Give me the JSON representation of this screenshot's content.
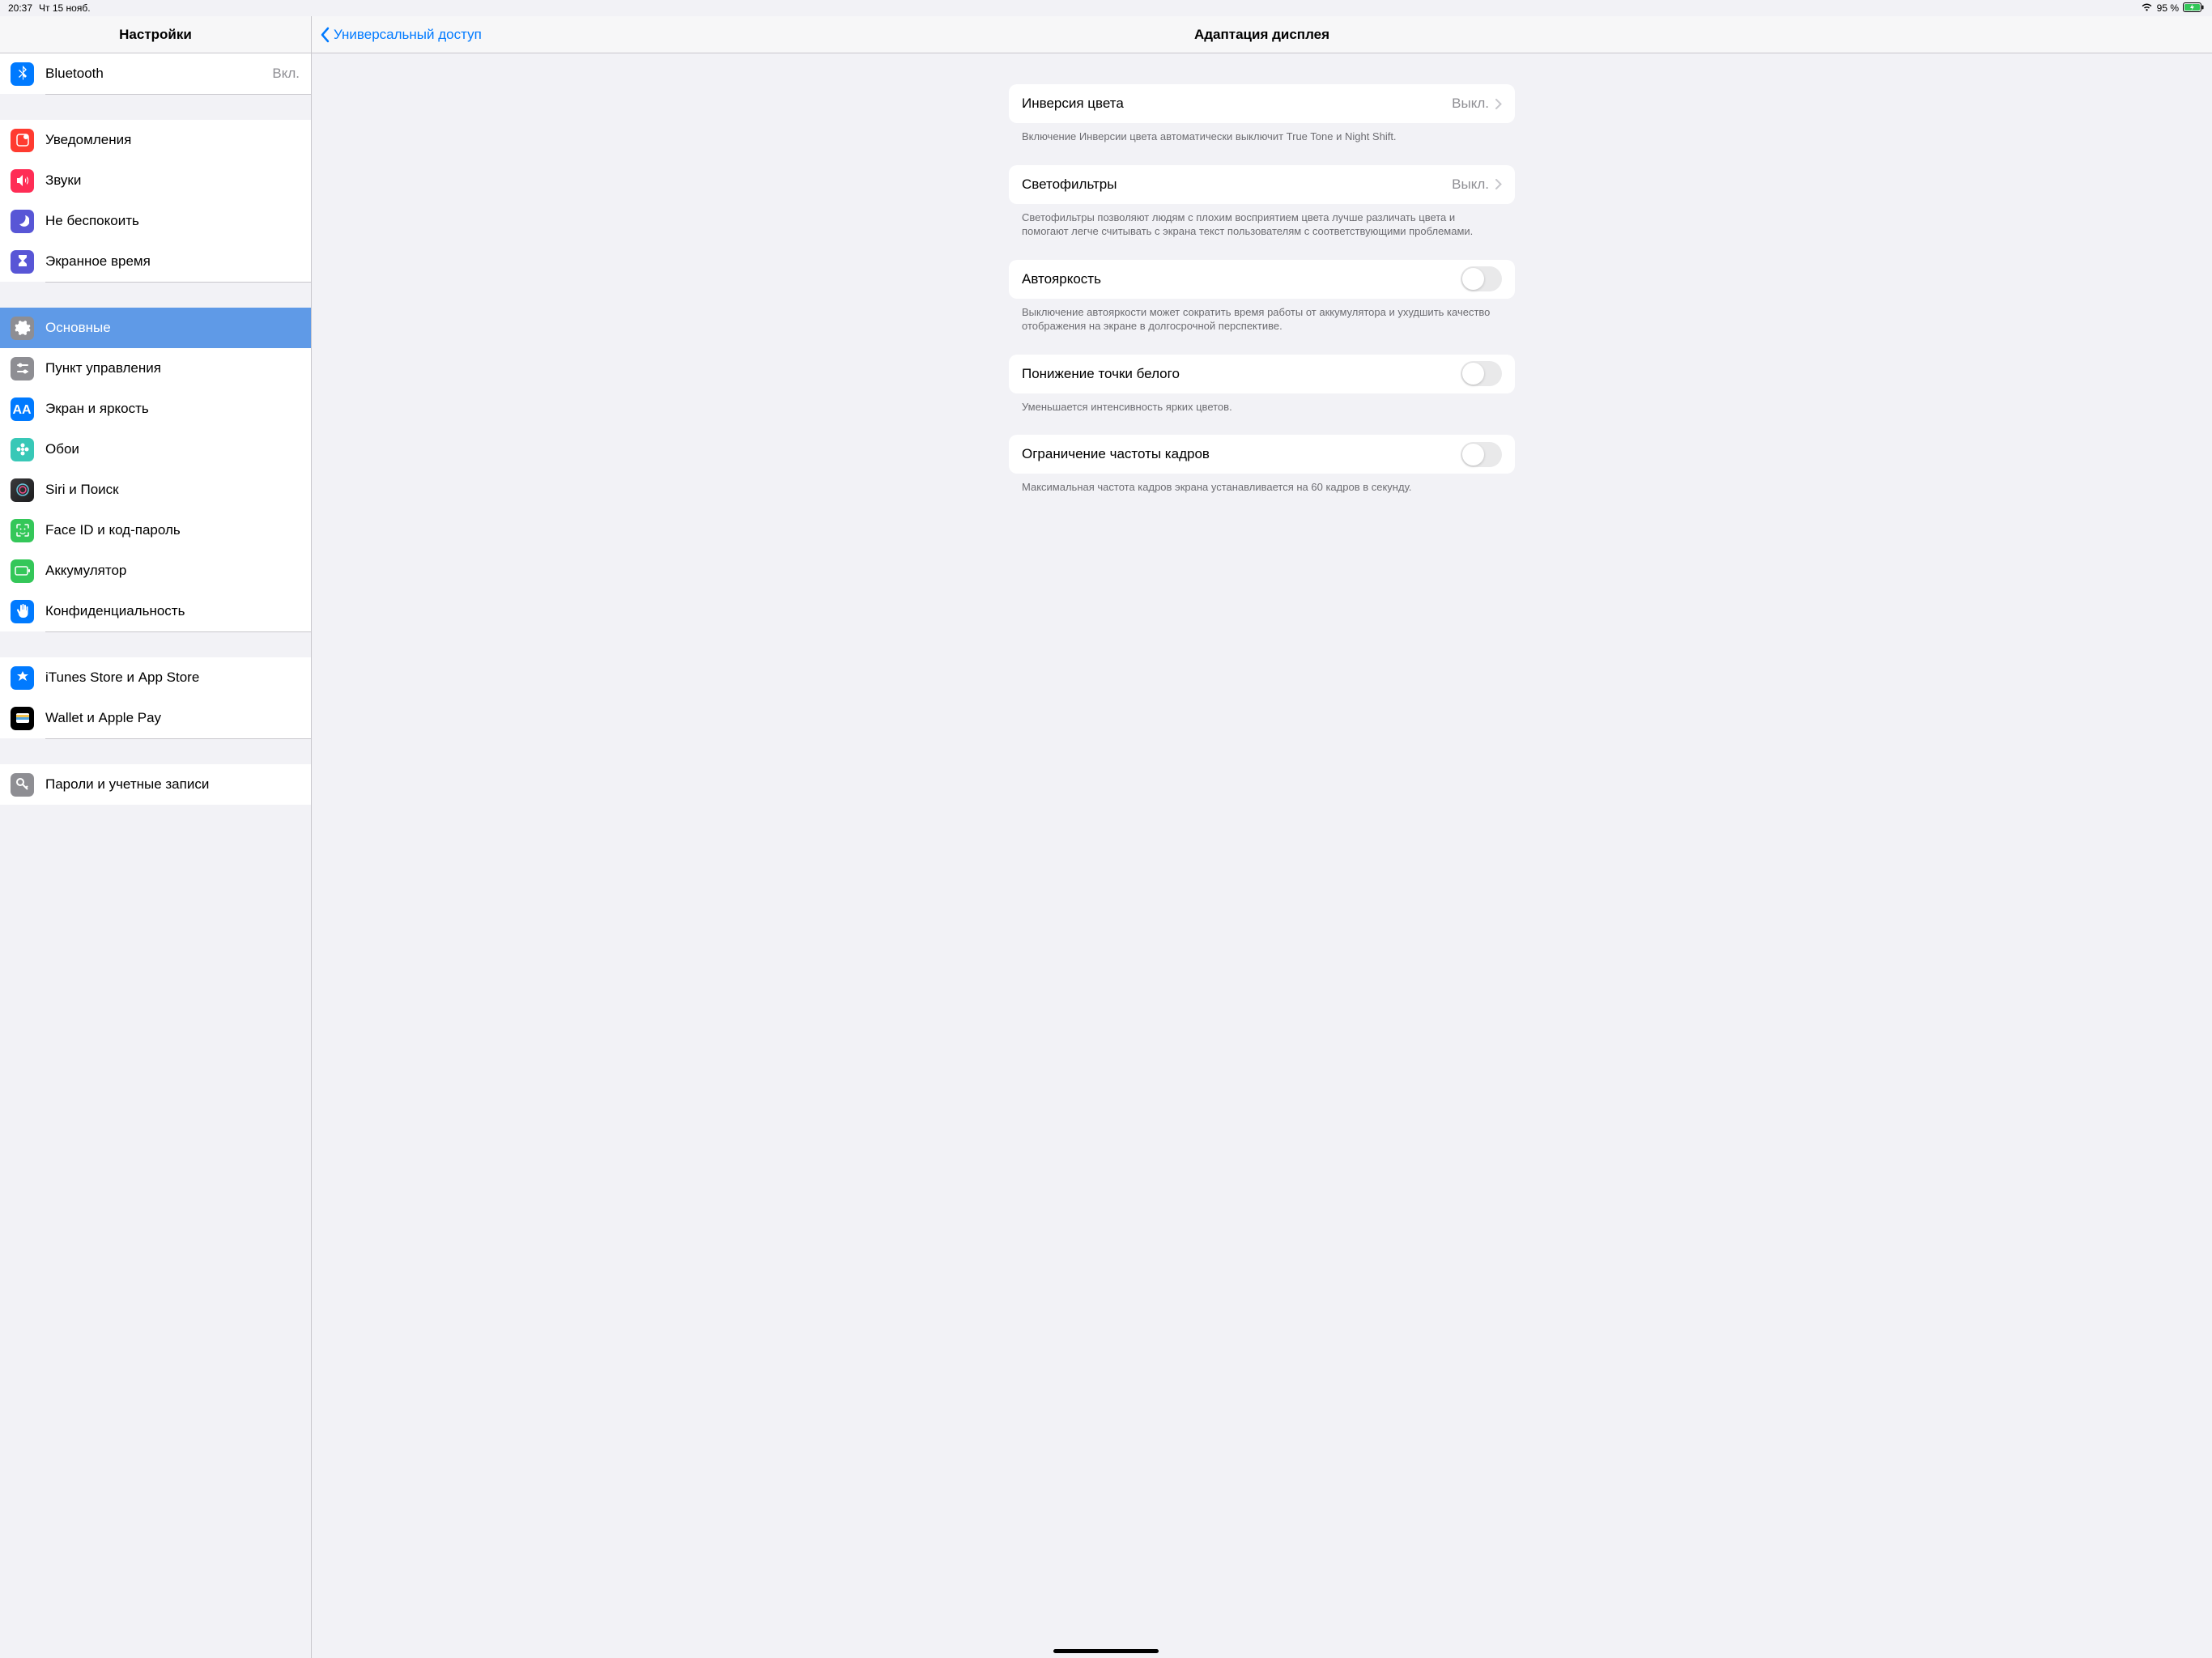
{
  "status": {
    "time": "20:37",
    "date": "Чт 15 нояб.",
    "battery": "95 %"
  },
  "sidebar": {
    "title": "Настройки",
    "groups": [
      [
        {
          "icon": "ic-blue",
          "glyph": "bluetooth",
          "label": "Bluetooth",
          "value": "Вкл."
        }
      ],
      [
        {
          "icon": "ic-notif",
          "glyph": "notif",
          "label": "Уведомления"
        },
        {
          "icon": "ic-sound",
          "glyph": "sound",
          "label": "Звуки"
        },
        {
          "icon": "ic-purple",
          "glyph": "moon",
          "label": "Не беспокоить"
        },
        {
          "icon": "ic-purple",
          "glyph": "hourglass",
          "label": "Экранное время"
        }
      ],
      [
        {
          "icon": "ic-general",
          "glyph": "gear",
          "label": "Основные",
          "selected": true
        },
        {
          "icon": "ic-cc",
          "glyph": "cc",
          "label": "Пункт управления"
        },
        {
          "icon": "ic-aa",
          "glyph": "aa",
          "label": "Экран и яркость"
        },
        {
          "icon": "ic-wall",
          "glyph": "flower",
          "label": "Обои"
        },
        {
          "icon": "ic-siri",
          "glyph": "siri",
          "label": "Siri и Поиск"
        },
        {
          "icon": "ic-face",
          "glyph": "face",
          "label": "Face ID и код-пароль"
        },
        {
          "icon": "ic-batt",
          "glyph": "batt",
          "label": "Аккумулятор"
        },
        {
          "icon": "ic-hand",
          "glyph": "hand",
          "label": "Конфиденциальность"
        }
      ],
      [
        {
          "icon": "ic-store",
          "glyph": "store",
          "label": "iTunes Store и App Store"
        },
        {
          "icon": "ic-wallet",
          "glyph": "wallet",
          "label": "Wallet и Apple Pay"
        }
      ],
      [
        {
          "icon": "ic-key",
          "glyph": "key",
          "label": "Пароли и учетные записи"
        }
      ]
    ]
  },
  "detail": {
    "back": "Универсальный доступ",
    "title": "Адаптация дисплея",
    "rows": [
      {
        "label": "Инверсия цвета",
        "value": "Выкл.",
        "type": "link",
        "footer": "Включение Инверсии цвета автоматически выключит True Tone и Night Shift."
      },
      {
        "label": "Светофильтры",
        "value": "Выкл.",
        "type": "link",
        "footer": "Светофильтры позволяют людям с плохим восприятием цвета лучше различать цвета и помогают легче считывать с экрана текст пользователям с соответствующими проблемами."
      },
      {
        "label": "Автояркость",
        "type": "toggle",
        "footer": "Выключение автояркости может сократить время работы от аккумулятора и ухудшить качество отображения на экране в долгосрочной перспективе."
      },
      {
        "label": "Понижение точки белого",
        "type": "toggle",
        "footer": "Уменьшается интенсивность ярких цветов."
      },
      {
        "label": "Ограничение частоты кадров",
        "type": "toggle",
        "footer": "Максимальная частота кадров экрана устанавливается на 60 кадров в секунду."
      }
    ]
  }
}
